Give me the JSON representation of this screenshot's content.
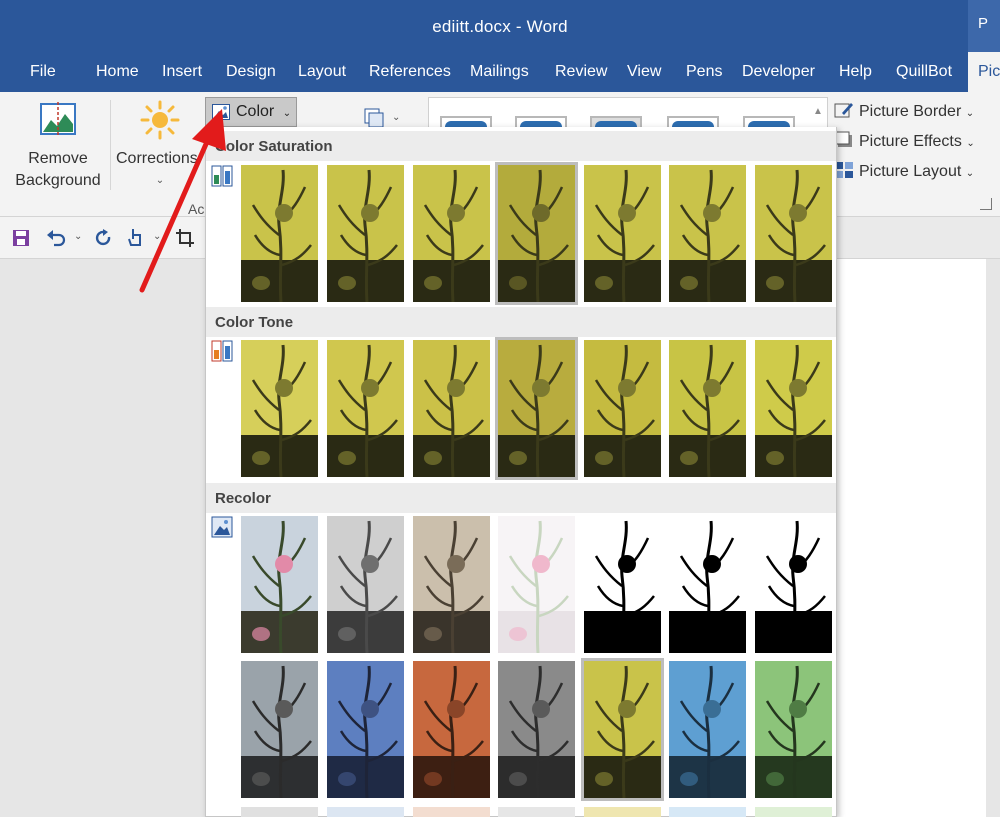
{
  "window": {
    "title": "ediitt.docx  -  Word",
    "corner_label": "P"
  },
  "tabs": [
    "File",
    "Home",
    "Insert",
    "Design",
    "Layout",
    "References",
    "Mailings",
    "Review",
    "View",
    "Pens",
    "Developer",
    "Help",
    "QuillBot",
    "Pic"
  ],
  "ribbon": {
    "remove_bg_line1": "Remove",
    "remove_bg_line2": "Background",
    "corrections": "Corrections",
    "color": "Color",
    "adjust_group_cut": "Ac",
    "picture_border": "Picture Border",
    "picture_effects": "Picture Effects",
    "picture_layout": "Picture Layout"
  },
  "gallery": {
    "sections": [
      {
        "title": "Color Saturation",
        "kind": "saturation",
        "thumbs": 7,
        "selected": 3
      },
      {
        "title": "Color Tone",
        "kind": "tone",
        "thumbs": 7,
        "selected": 3
      },
      {
        "title": "Recolor",
        "kind": "recolor",
        "selected_row2": 4
      }
    ],
    "colors": {
      "yellow": "#c9c34a",
      "dark": "#2a2a14",
      "gray": "#8a8a8a",
      "blue": "#5d7fc0",
      "orange": "#c7683e",
      "lightblue": "#5e9fd2",
      "green": "#8cc47a",
      "pink": "#e28aa8"
    }
  },
  "icons": {
    "save": "save-icon",
    "undo": "undo-icon",
    "redo": "redo-icon",
    "touch": "touch-mode-icon",
    "crop": "crop-icon"
  }
}
